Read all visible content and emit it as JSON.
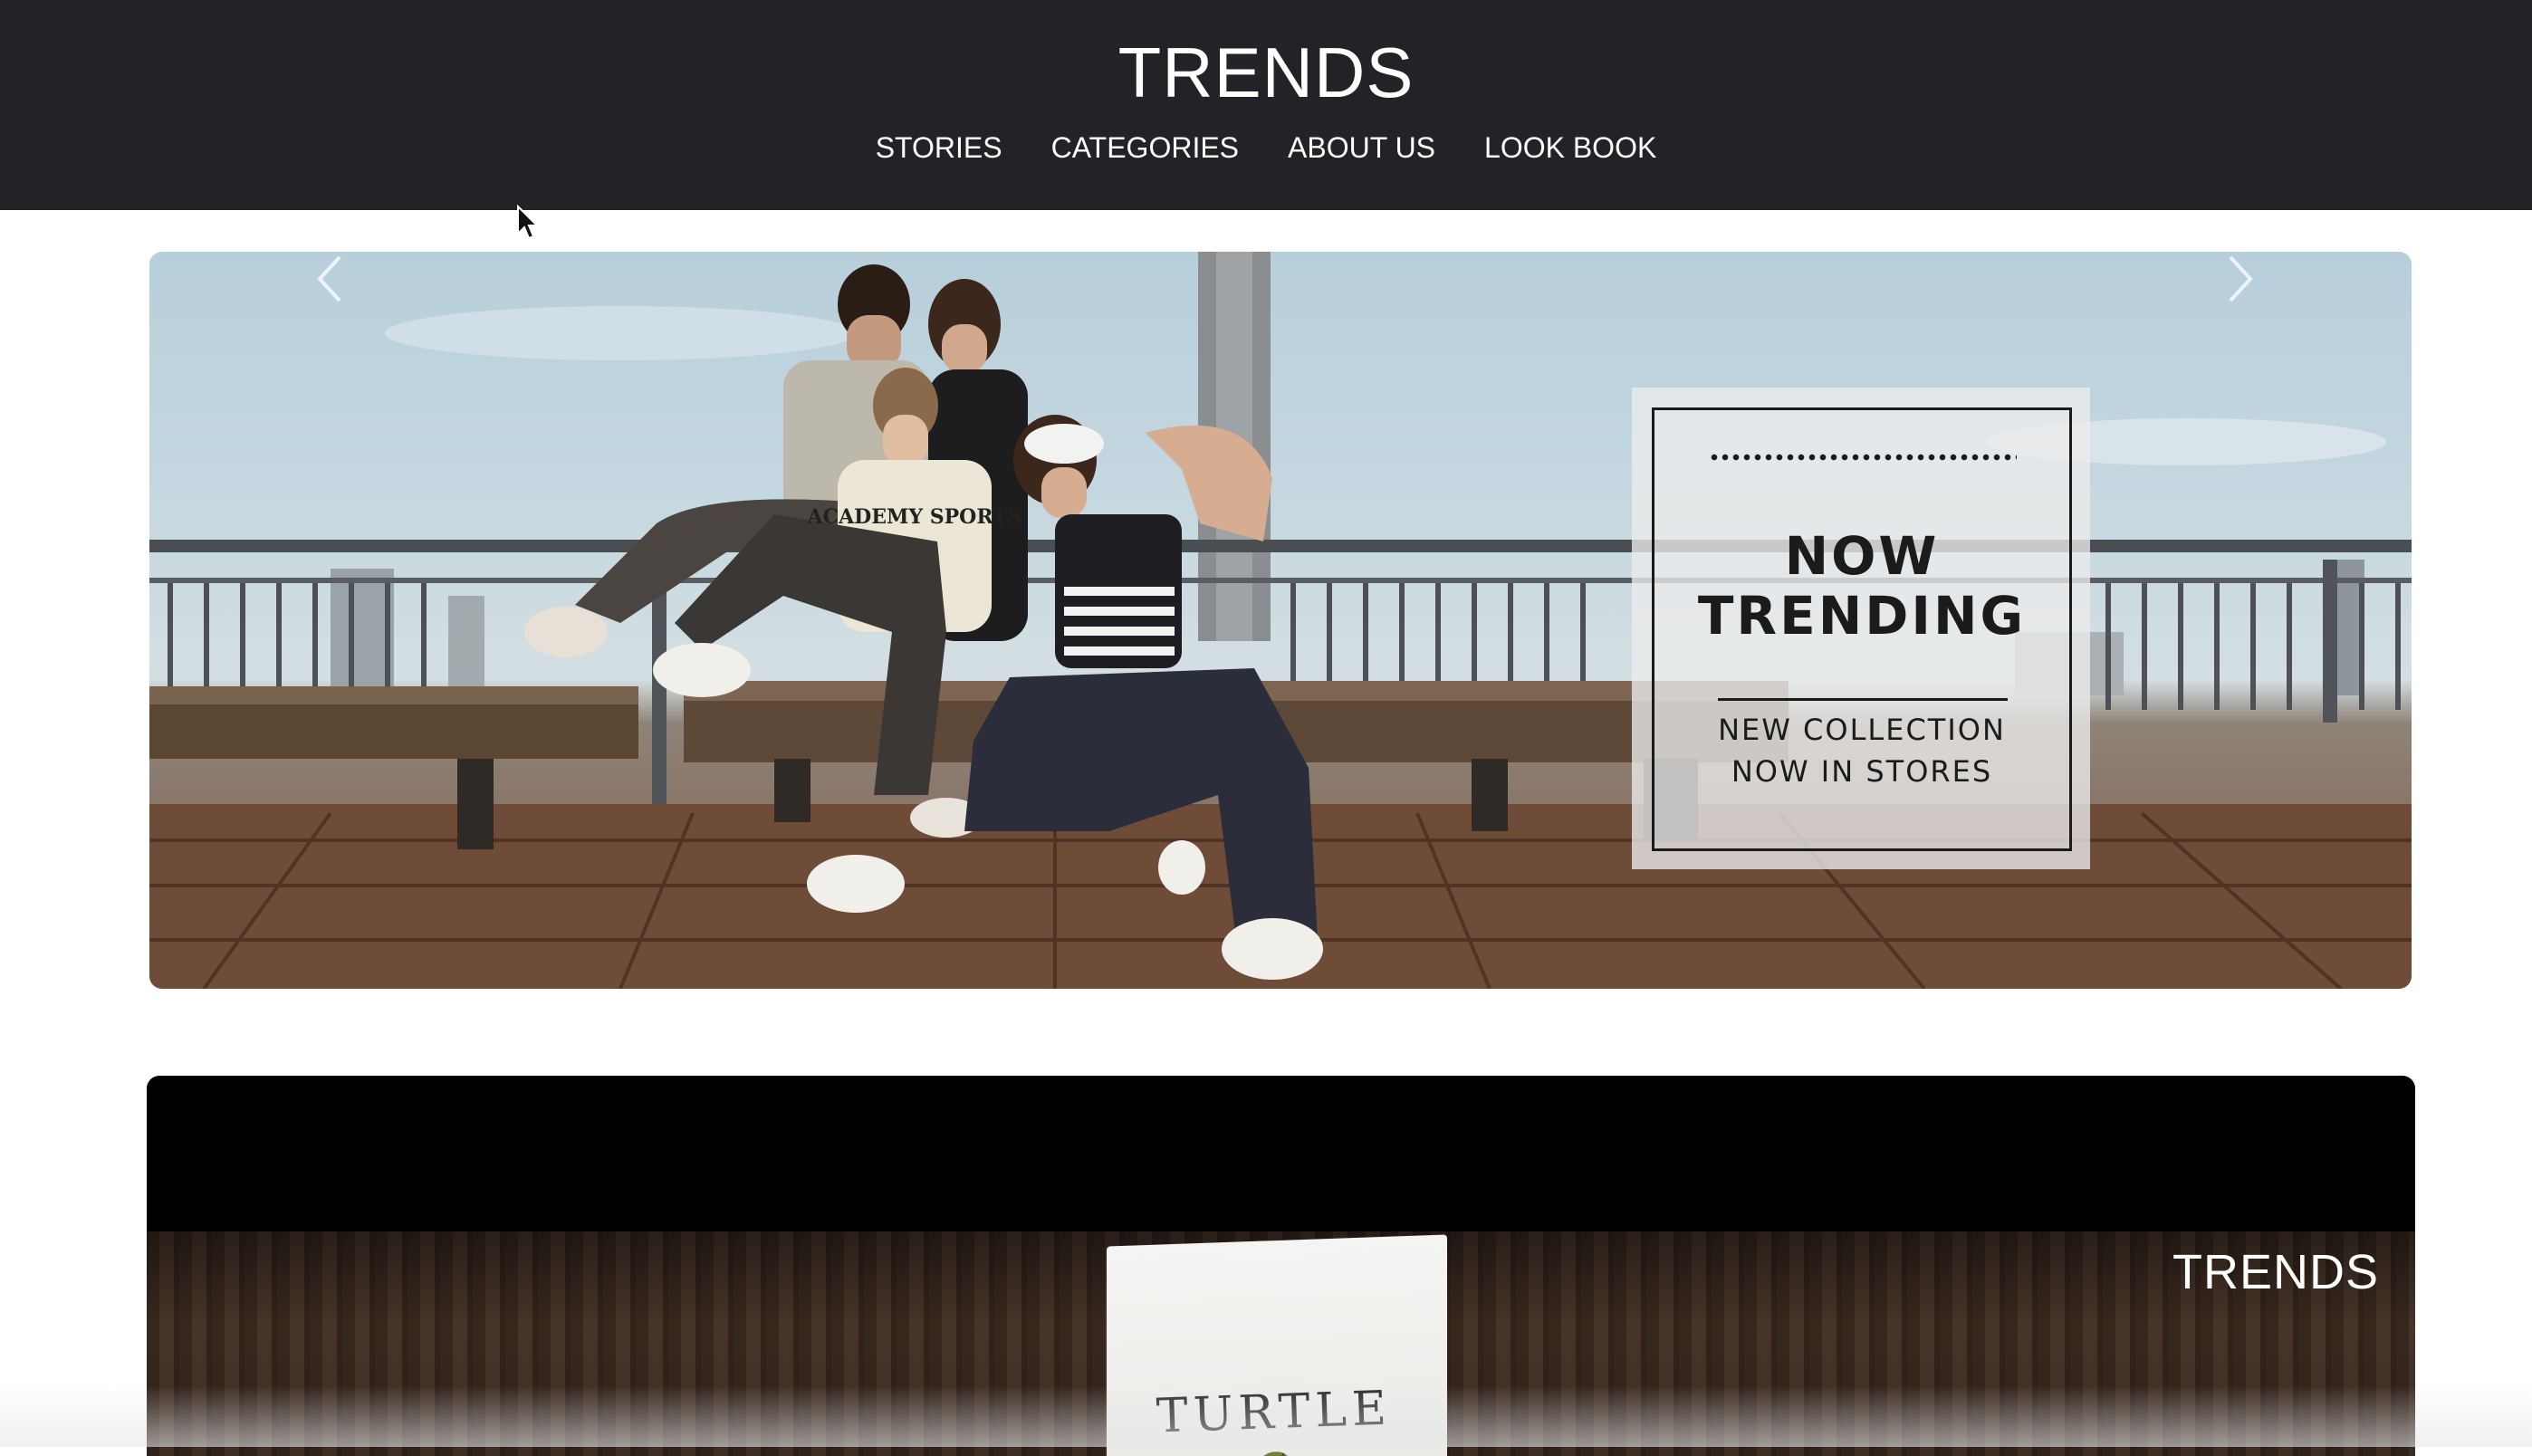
{
  "header": {
    "brand": "TRENDS",
    "nav": [
      {
        "label": "STORIES"
      },
      {
        "label": "CATEGORIES"
      },
      {
        "label": "ABOUT US"
      },
      {
        "label": "LOOK BOOK"
      }
    ]
  },
  "hero": {
    "promo": {
      "title_line1": "NOW",
      "title_line2": "TRENDING",
      "subtitle_line1": "NEW COLLECTION",
      "subtitle_line2": "NOW IN STORES"
    },
    "shirt_text": "ACADEMY SPORTS",
    "icons": {
      "prev": "chevron-left-icon",
      "next": "chevron-right-icon"
    }
  },
  "banner2": {
    "brand": "TRENDS",
    "sign_text": "TURTLE"
  },
  "colors": {
    "header_bg": "#232327",
    "page_bg": "#ffffff",
    "promo_text": "#1b1b1b"
  }
}
